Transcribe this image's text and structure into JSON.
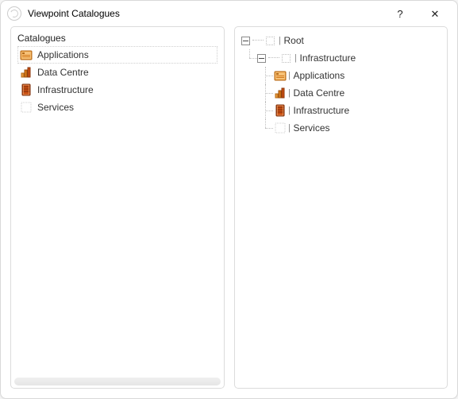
{
  "window": {
    "title": "Viewpoint Catalogues"
  },
  "left": {
    "header": "Catalogues",
    "items": [
      {
        "label": "Applications",
        "icon": "applications-icon",
        "selected": true
      },
      {
        "label": "Data Centre",
        "icon": "data-centre-icon",
        "selected": false
      },
      {
        "label": "Infrastructure",
        "icon": "infrastructure-icon",
        "selected": false
      },
      {
        "label": "Services",
        "icon": "none",
        "selected": false
      }
    ]
  },
  "tree": {
    "root": {
      "label": "Root",
      "expanded": true,
      "children": [
        {
          "label": "Infrastructure",
          "expanded": true,
          "children": [
            {
              "label": "Applications",
              "icon": "applications-icon"
            },
            {
              "label": "Data Centre",
              "icon": "data-centre-icon"
            },
            {
              "label": "Infrastructure",
              "icon": "infrastructure-icon"
            },
            {
              "label": "Services",
              "icon": "none"
            }
          ]
        }
      ]
    }
  }
}
